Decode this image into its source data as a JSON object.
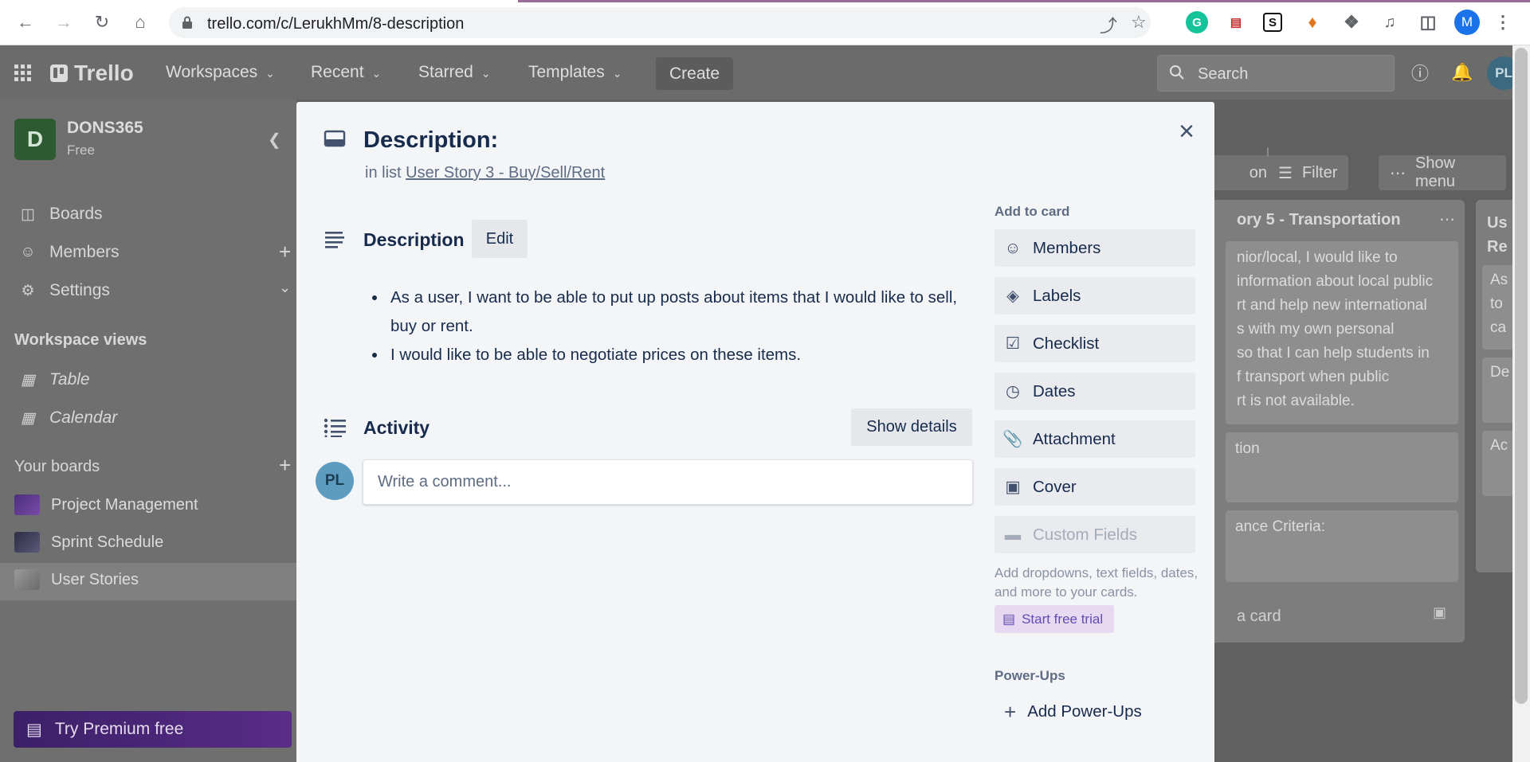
{
  "browser": {
    "url": "trello.com/c/LerukhMm/8-description",
    "profile_initial": "M",
    "extensions": [
      "grammarly-icon",
      "pdf-icon",
      "s-extension-icon",
      "metamask-fox-icon",
      "puzzle-icon",
      "media-icon",
      "sidepanel-icon"
    ]
  },
  "header": {
    "logo": "Trello",
    "nav": [
      "Workspaces",
      "Recent",
      "Starred",
      "Templates"
    ],
    "create_label": "Create",
    "search_placeholder": "Search",
    "avatar_initials": "PL"
  },
  "sidebar": {
    "workspace_initial": "D",
    "workspace_name": "DONS365",
    "workspace_plan": "Free",
    "items": [
      {
        "label": "Boards",
        "icon": "boards-icon"
      },
      {
        "label": "Members",
        "icon": "members-icon"
      },
      {
        "label": "Settings",
        "icon": "settings-icon"
      }
    ],
    "views_heading": "Workspace views",
    "views": [
      {
        "label": "Table",
        "icon": "table-icon"
      },
      {
        "label": "Calendar",
        "icon": "calendar-icon"
      }
    ],
    "boards_heading": "Your boards",
    "boards": [
      {
        "label": "Project Management",
        "color": "#5a3d8a"
      },
      {
        "label": "Sprint Schedule",
        "color": "#3a3a55"
      },
      {
        "label": "User Stories",
        "color": "#8a8a8a"
      }
    ],
    "premium_label": "Try Premium free"
  },
  "board": {
    "toolbar": {
      "partial_label": "on",
      "filter_label": "Filter",
      "menu_label": "Show menu"
    },
    "list_title": "ory 5 - Transportation",
    "card_text": "nior/local, I would like to\ninformation about local public\nrt and help new international\ns with my own personal\nso that I can help students in\nf transport when public\nrt is not available.",
    "card2": "tion",
    "card3": "ance Criteria:",
    "add_card": "a card",
    "next_list_title": "Us\nRe",
    "next_list_cards": [
      "As\nto\nca",
      "De",
      "Ac"
    ]
  },
  "modal": {
    "title": "Description:",
    "in_list_prefix": "in list",
    "list_name": "User Story 3 - Buy/Sell/Rent",
    "description_heading": "Description",
    "edit_label": "Edit",
    "description_items": [
      "As a user, I want to be able to put up posts about items that I would like to sell, buy or rent.",
      "I would like to be able to negotiate prices on these items."
    ],
    "activity_heading": "Activity",
    "show_details_label": "Show details",
    "commenter_initials": "PL",
    "comment_placeholder": "Write a comment...",
    "add_to_card_heading": "Add to card",
    "add_to_card": [
      "Members",
      "Labels",
      "Checklist",
      "Dates",
      "Attachment",
      "Cover",
      "Custom Fields"
    ],
    "custom_fields_help": "Add dropdowns, text fields, dates, and more to your cards.",
    "trial_label": "Start free trial",
    "powerups_heading": "Power-Ups",
    "add_powerups_label": "Add Power-Ups"
  }
}
